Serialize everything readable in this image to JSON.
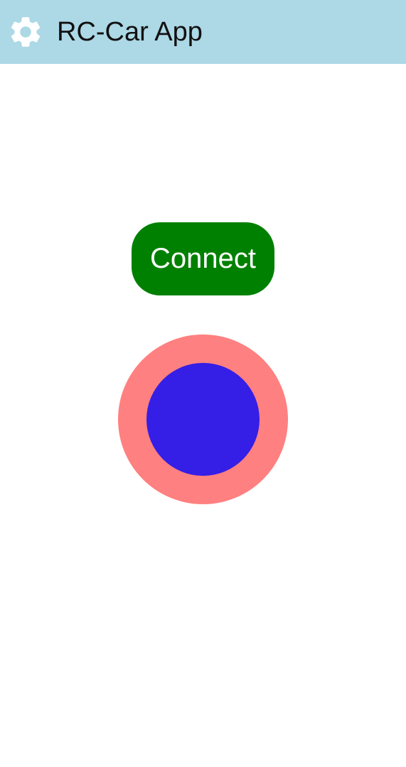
{
  "app_bar": {
    "title": "RC-Car App",
    "settings_icon": "gear-icon",
    "background_color": "#add8e6"
  },
  "connect_button": {
    "label": "Connect",
    "color": "#008000"
  },
  "joystick": {
    "base_color": "#ff8080",
    "knob_color": "#351ee6",
    "knob_offset_x": 0,
    "knob_offset_y": 0
  }
}
